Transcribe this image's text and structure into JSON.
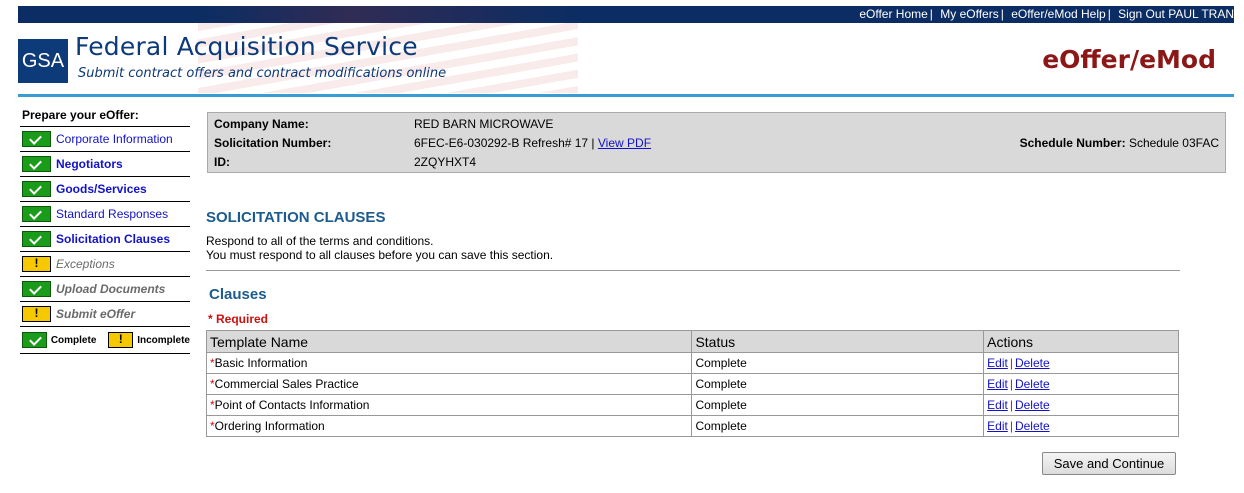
{
  "topnav": {
    "links": [
      "eOffer Home",
      "My eOffers",
      "eOffer/eMod Help",
      "Sign Out PAUL TRAN"
    ]
  },
  "header": {
    "logo_text": "GSA",
    "title": "Federal Acquisition Service",
    "subtitle": "Submit contract offers and contract modifications online",
    "app_title": "eOffer/eMod"
  },
  "sidebar": {
    "heading": "Prepare your eOffer:",
    "items": [
      {
        "label": "Corporate Information",
        "status": "complete"
      },
      {
        "label": "Negotiators",
        "status": "complete"
      },
      {
        "label": "Goods/Services",
        "status": "complete"
      },
      {
        "label": "Standard Responses",
        "status": "complete"
      },
      {
        "label": "Solicitation Clauses",
        "status": "complete"
      },
      {
        "label": "Exceptions",
        "status": "incomplete"
      },
      {
        "label": "Upload Documents",
        "status": "complete"
      },
      {
        "label": "Submit eOffer",
        "status": "incomplete"
      }
    ],
    "legend": {
      "complete": "Complete",
      "incomplete": "Incomplete"
    }
  },
  "company": {
    "company_name_label": "Company Name:",
    "company_name": "RED BARN MICROWAVE",
    "solicitation_label": "Solicitation Number:",
    "solicitation_value": "6FEC-E6-030292-B Refresh# 17 |",
    "view_pdf": "View PDF",
    "id_label": "ID:",
    "id_value": "2ZQYHXT4",
    "schedule_label": "Schedule Number:",
    "schedule_value": "Schedule 03FAC"
  },
  "main": {
    "section_title": "SOLICITATION CLAUSES",
    "instruction_1": "Respond to all of the terms and conditions.",
    "instruction_2": "You must respond to all clauses before you can save this section.",
    "clauses_title": "Clauses",
    "required_note": "* Required"
  },
  "table": {
    "headers": [
      "Template Name",
      "Status",
      "Actions"
    ],
    "rows": [
      {
        "name": "Basic Information",
        "status": "Complete",
        "edit": "Edit",
        "delete": "Delete"
      },
      {
        "name": "Commercial Sales Practice",
        "status": "Complete",
        "edit": "Edit",
        "delete": "Delete"
      },
      {
        "name": "Point of Contacts Information",
        "status": "Complete",
        "edit": "Edit",
        "delete": "Delete"
      },
      {
        "name": "Ordering Information",
        "status": "Complete",
        "edit": "Edit",
        "delete": "Delete"
      }
    ]
  },
  "buttons": {
    "save_continue": "Save and Continue"
  },
  "colors": {
    "nav_bg": "#0b2d63",
    "brand_blue": "#0d3a78",
    "app_title": "#8b1717",
    "accent_rule": "#3a9dd1",
    "complete": "#1a9b1a",
    "incomplete": "#f6c800"
  }
}
